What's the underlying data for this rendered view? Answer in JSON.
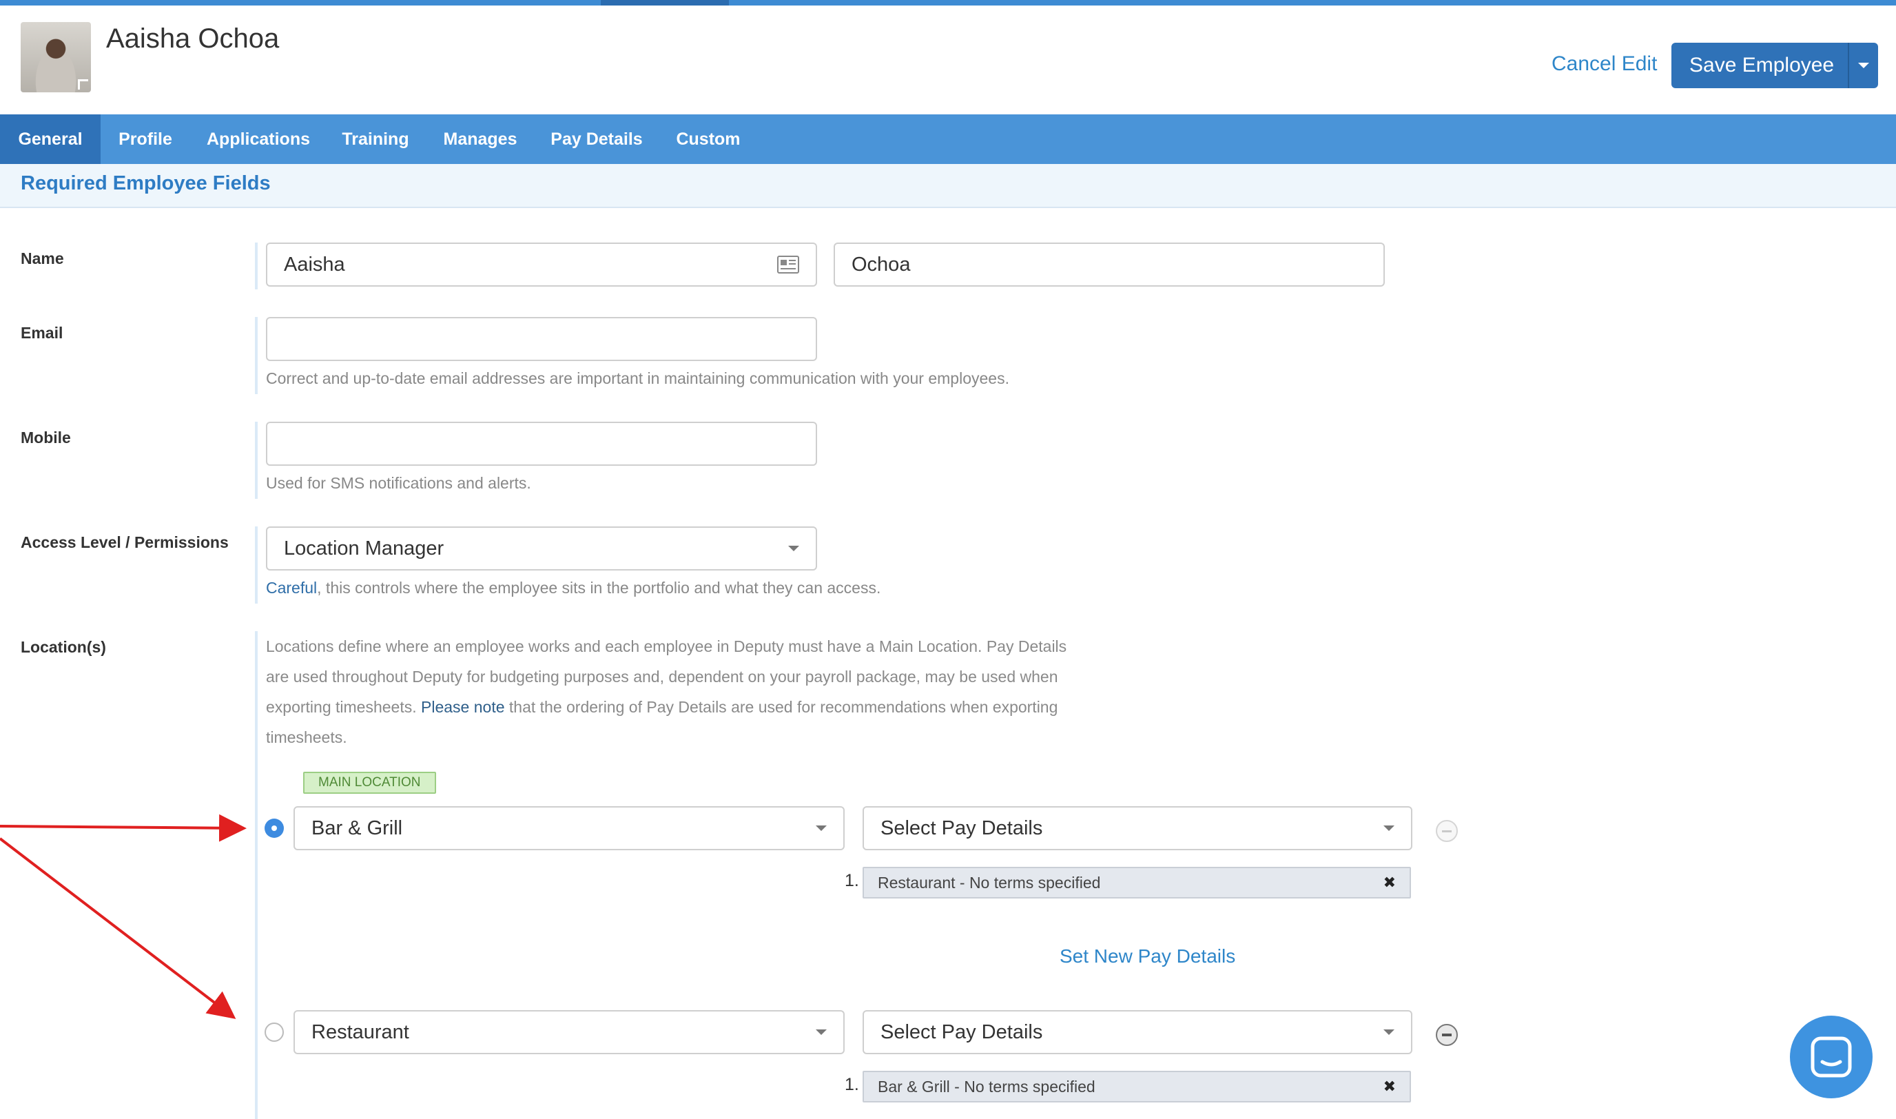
{
  "header": {
    "employee_name": "Aaisha Ochoa",
    "cancel_label": "Cancel Edit",
    "save_label": "Save Employee"
  },
  "tabs": [
    {
      "label": "General",
      "active": true
    },
    {
      "label": "Profile"
    },
    {
      "label": "Applications"
    },
    {
      "label": "Training"
    },
    {
      "label": "Manages"
    },
    {
      "label": "Pay Details"
    },
    {
      "label": "Custom"
    }
  ],
  "section": {
    "title": "Required Employee Fields"
  },
  "fields": {
    "name": {
      "label": "Name",
      "first": "Aaisha",
      "last": "Ochoa"
    },
    "email": {
      "label": "Email",
      "value": "",
      "help": "Correct and up-to-date email addresses are important in maintaining communication with your employees."
    },
    "mobile": {
      "label": "Mobile",
      "value": "",
      "help": "Used for SMS notifications and alerts."
    },
    "access": {
      "label": "Access Level / Permissions",
      "value": "Location Manager",
      "help_strong": "Careful",
      "help_rest": ", this controls where the employee sits in the portfolio and what they can access."
    },
    "locations": {
      "label": "Location(s)",
      "note_part1": "Locations define where an employee works and each employee in Deputy must have a Main Location. Pay Details are used throughout Deputy for budgeting purposes and, dependent on your payroll package, may be used when exporting timesheets. ",
      "note_strong": "Please note",
      "note_part2": " that the ordering of Pay Details are used for recommendations when exporting timesheets.",
      "main_tag": "MAIN LOCATION",
      "rows": [
        {
          "location": "Bar & Grill",
          "pay_select": "Select Pay Details",
          "pay_num": "1.",
          "pay_item": "Restaurant - No terms specified",
          "main": true
        },
        {
          "location": "Restaurant",
          "pay_select": "Select Pay Details",
          "pay_num": "1.",
          "pay_item": "Bar & Grill - No terms specified",
          "main": false
        }
      ],
      "set_new_label": "Set New Pay Details"
    }
  },
  "colors": {
    "accent": "#4a94d8",
    "primary": "#2f72b8",
    "link": "#2e86c9",
    "arrow": "#e02020"
  },
  "icons": [
    "contact-card-icon",
    "chevron-down-icon",
    "remove-icon",
    "close-icon",
    "chat-icon"
  ]
}
